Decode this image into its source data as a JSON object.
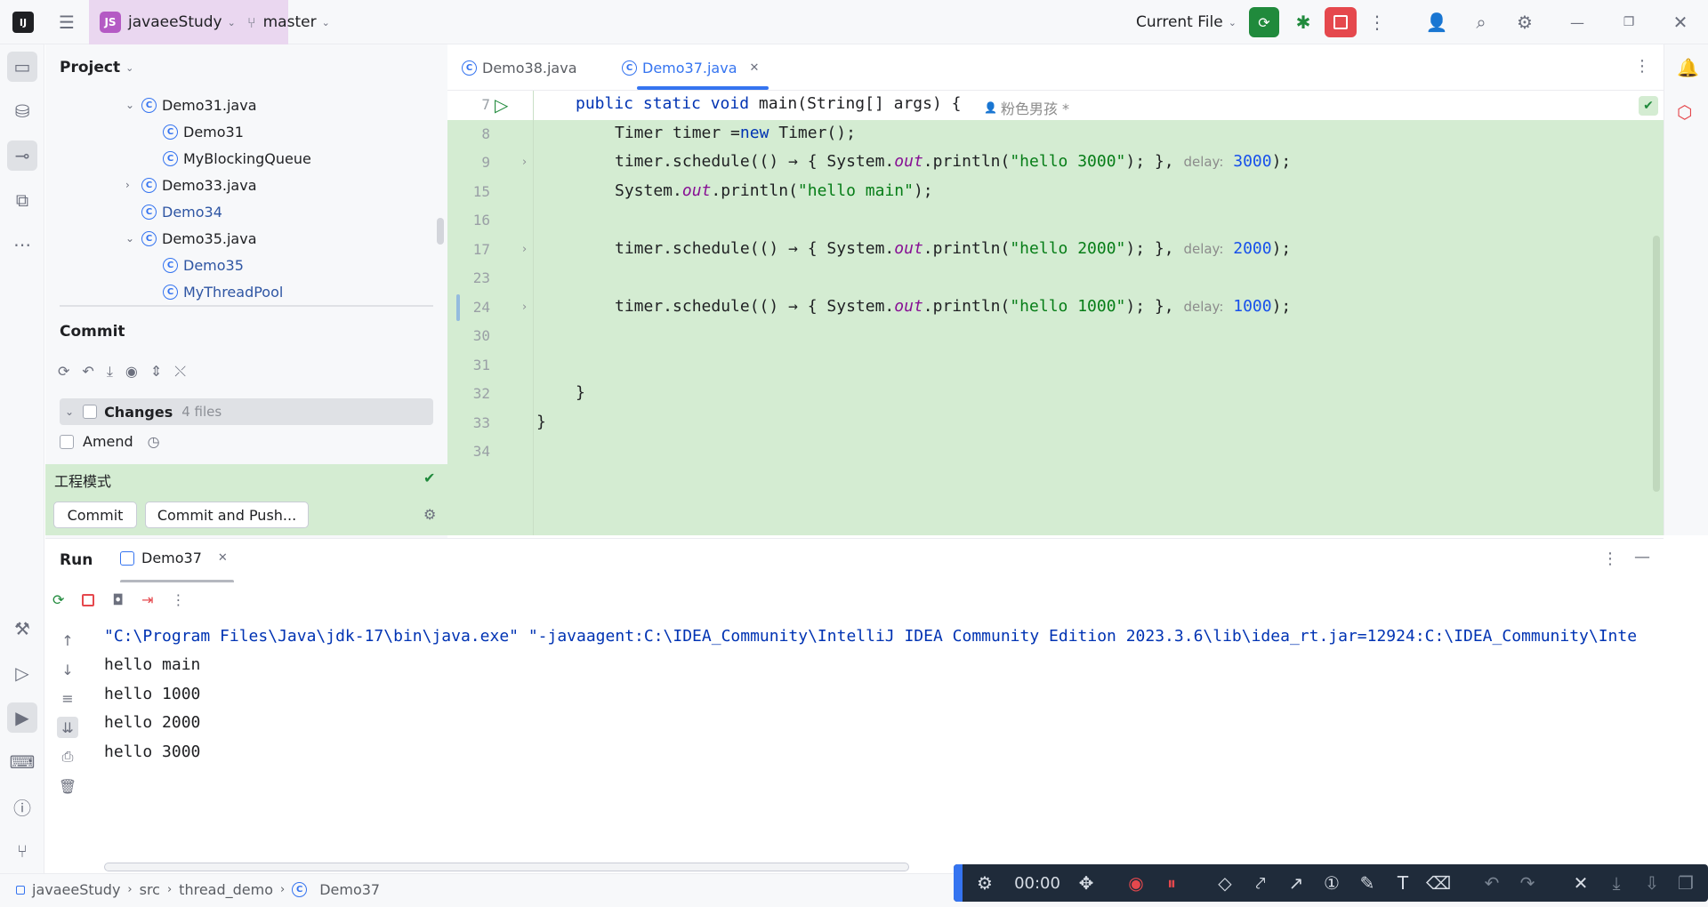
{
  "titlebar": {
    "project_badge": "JS",
    "project_name": "javaeeStudy",
    "branch": "master",
    "run_config": "Current File"
  },
  "project_panel": {
    "title": "Project",
    "tree": [
      {
        "label": "Demo31.java",
        "expanded": true
      },
      {
        "label": "Demo31"
      },
      {
        "label": "MyBlockingQueue"
      },
      {
        "label": "Demo33.java",
        "expanded": false
      },
      {
        "label": "Demo34"
      },
      {
        "label": "Demo35.java",
        "expanded": true
      },
      {
        "label": "Demo35"
      },
      {
        "label": "MyThreadPool"
      }
    ]
  },
  "commit_panel": {
    "title": "Commit",
    "changes_label": "Changes",
    "changes_count": "4 files",
    "amend_label": "Amend",
    "message": "工程模式",
    "commit_button": "Commit",
    "commit_push_button": "Commit and Push..."
  },
  "editor": {
    "tabs": [
      {
        "label": "Demo38.java",
        "active": false
      },
      {
        "label": "Demo37.java",
        "active": true
      }
    ],
    "author_hint": "粉色男孩 *",
    "lines": [
      {
        "num": "7"
      },
      {
        "num": "8"
      },
      {
        "num": "9"
      },
      {
        "num": "15"
      },
      {
        "num": "16"
      },
      {
        "num": "17"
      },
      {
        "num": "23"
      },
      {
        "num": "24"
      },
      {
        "num": "30"
      },
      {
        "num": "31"
      },
      {
        "num": "32"
      },
      {
        "num": "33"
      },
      {
        "num": "34"
      }
    ],
    "code": {
      "l7_kw": "public static void ",
      "l7_rest": "main(String[] args) {",
      "l8_a": "Timer timer =",
      "l8_kw": "new",
      "l8_b": " Timer();",
      "sched_a": "timer.schedule(() → { System.",
      "out": "out",
      "println": ".println(",
      "str_3000": "\"hello 3000\"",
      "str_2000": "\"hello 2000\"",
      "str_1000": "\"hello 1000\"",
      "str_main": "\"hello main\"",
      "sched_close": "); }",
      "delay_hint": "delay:",
      "val_3000": "3000",
      "val_2000": "2000",
      "val_1000": "1000",
      "paren_end": ");",
      "sys_a": "System.",
      "close_brace": "}"
    }
  },
  "run_panel": {
    "title": "Run",
    "tab": "Demo37",
    "output": [
      "\"C:\\Program Files\\Java\\jdk-17\\bin\\java.exe\" \"-javaagent:C:\\IDEA_Community\\IntelliJ IDEA Community Edition 2023.3.6\\lib\\idea_rt.jar=12924:C:\\IDEA_Community\\Inte",
      "hello main",
      "hello 1000",
      "hello 2000",
      "hello 3000"
    ]
  },
  "statusbar": {
    "breadcrumb": [
      "javaeeStudy",
      "src",
      "thread_demo",
      "Demo37"
    ]
  },
  "recorder": {
    "timer": "00:00"
  }
}
